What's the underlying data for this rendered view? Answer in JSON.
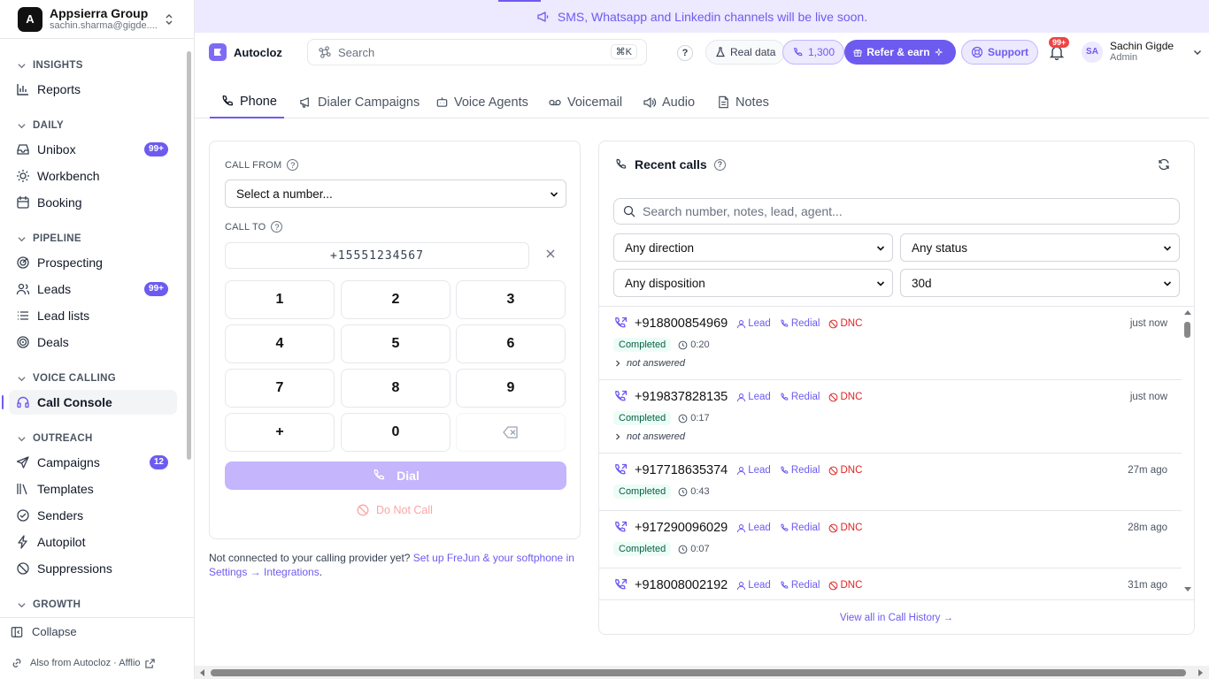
{
  "workspace": {
    "avatar_letter": "A",
    "name": "Appsierra Group",
    "email": "sachin.sharma@gigde...."
  },
  "sidebar": {
    "sections": [
      {
        "label": "INSIGHTS",
        "items": [
          {
            "label": "Reports",
            "icon": "bar-chart-icon"
          }
        ]
      },
      {
        "label": "DAILY",
        "items": [
          {
            "label": "Unibox",
            "icon": "inbox-icon",
            "badge": "99+"
          },
          {
            "label": "Workbench",
            "icon": "sun-icon"
          },
          {
            "label": "Booking",
            "icon": "calendar-icon"
          }
        ]
      },
      {
        "label": "PIPELINE",
        "items": [
          {
            "label": "Prospecting",
            "icon": "target-icon"
          },
          {
            "label": "Leads",
            "icon": "users-icon",
            "badge": "99+"
          },
          {
            "label": "Lead lists",
            "icon": "list-icon"
          },
          {
            "label": "Deals",
            "icon": "target-circle-icon"
          }
        ]
      },
      {
        "label": "VOICE CALLING",
        "items": [
          {
            "label": "Call Console",
            "icon": "headset-icon",
            "active": true
          }
        ]
      },
      {
        "label": "OUTREACH",
        "items": [
          {
            "label": "Campaigns",
            "icon": "send-icon",
            "badge": "12"
          },
          {
            "label": "Templates",
            "icon": "library-icon"
          },
          {
            "label": "Senders",
            "icon": "check-circle-icon"
          },
          {
            "label": "Autopilot",
            "icon": "bolt-icon"
          },
          {
            "label": "Suppressions",
            "icon": "ban-icon"
          }
        ]
      },
      {
        "label": "GROWTH",
        "items": []
      }
    ],
    "collapse_label": "Collapse",
    "also_from": "Also from Autocloz · Afflio"
  },
  "banner": {
    "text": "SMS, Whatsapp and Linkedin channels will be live soon."
  },
  "topbar": {
    "brand": "Autocloz",
    "search_placeholder": "Search",
    "search_shortcut": "⌘K",
    "help": "?",
    "real_data": "Real data",
    "credits": "1,300",
    "refer": "Refer & earn",
    "support": "Support",
    "notif_badge": "99+",
    "user_initials": "SA",
    "user_name": "Sachin Gigde",
    "user_role": "Admin"
  },
  "tabs": [
    {
      "label": "Phone",
      "icon": "phone-icon",
      "active": true
    },
    {
      "label": "Dialer Campaigns",
      "icon": "megaphone-icon"
    },
    {
      "label": "Voice Agents",
      "icon": "bot-icon"
    },
    {
      "label": "Voicemail",
      "icon": "voicemail-icon"
    },
    {
      "label": "Audio",
      "icon": "speaker-icon"
    },
    {
      "label": "Notes",
      "icon": "note-icon"
    }
  ],
  "dialer": {
    "call_from_label": "CALL FROM",
    "call_from_value": "Select a number...",
    "call_to_label": "CALL TO",
    "call_to_value": "+15551234567",
    "keys": [
      "1",
      "2",
      "3",
      "4",
      "5",
      "6",
      "7",
      "8",
      "9",
      "+",
      "0"
    ],
    "dial_label": "Dial",
    "dnc_label": "Do Not Call"
  },
  "note": {
    "text": "Not connected to your calling provider yet? ",
    "link": "Set up FreJun & your softphone in Settings → Integrations",
    "end": "."
  },
  "recent": {
    "title": "Recent calls",
    "search_placeholder": "Search number, notes, lead, agent...",
    "filters": {
      "direction": "Any direction",
      "status": "Any status",
      "disposition": "Any disposition",
      "range": "30d"
    },
    "tag_labels": {
      "lead": "Lead",
      "redial": "Redial",
      "dnc": "DNC"
    },
    "calls": [
      {
        "number": "+918800854969",
        "time": "just now",
        "status": "Completed",
        "duration": "0:20",
        "note": "not answered"
      },
      {
        "number": "+919837828135",
        "time": "just now",
        "status": "Completed",
        "duration": "0:17",
        "note": "not answered"
      },
      {
        "number": "+917718635374",
        "time": "27m ago",
        "status": "Completed",
        "duration": "0:43",
        "note": ""
      },
      {
        "number": "+917290096029",
        "time": "28m ago",
        "status": "Completed",
        "duration": "0:07",
        "note": ""
      },
      {
        "number": "+918008002192",
        "time": "31m ago",
        "status": "",
        "duration": "",
        "note": ""
      }
    ],
    "footer": "View all in Call History →"
  },
  "colors": {
    "accent": "#6d5bf0",
    "banner_bg": "#ede9fe",
    "danger": "#dc2626"
  }
}
